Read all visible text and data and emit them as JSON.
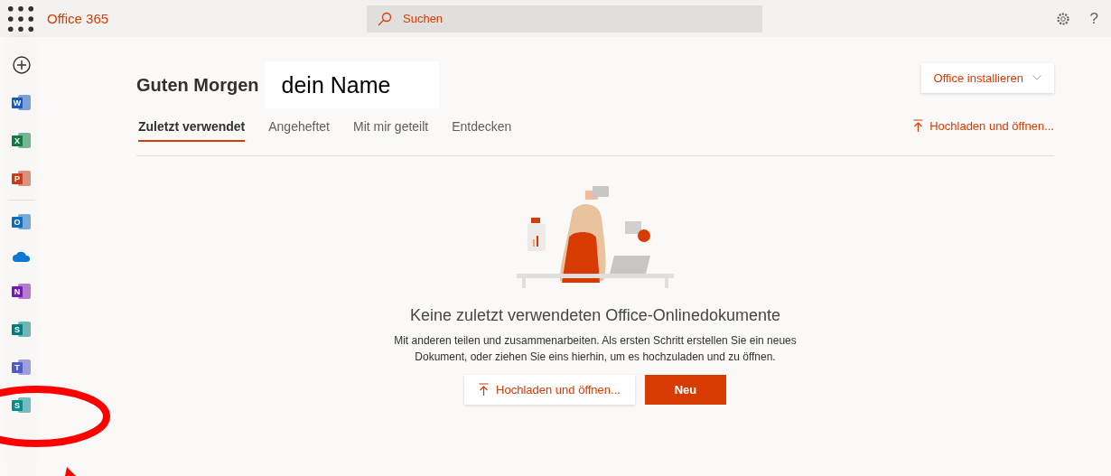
{
  "top_bar": {
    "brand": "Office 365",
    "search": {
      "placeholder": "Suchen"
    },
    "help": "?"
  },
  "sidebar": {
    "items": [
      {
        "kind": "create"
      },
      {
        "kind": "app",
        "letter": "W",
        "color": "#185abd"
      },
      {
        "kind": "app",
        "letter": "X",
        "color": "#107c41"
      },
      {
        "kind": "app",
        "letter": "P",
        "color": "#c43e1c"
      },
      {
        "kind": "divider"
      },
      {
        "kind": "app",
        "letter": "O",
        "color": "#0f6cbd"
      },
      {
        "kind": "cloud",
        "color": "#0f78d4"
      },
      {
        "kind": "app",
        "letter": "N",
        "color": "#7719aa"
      },
      {
        "kind": "app",
        "letter": "S",
        "color": "#037c7e"
      },
      {
        "kind": "app",
        "letter": "T",
        "color": "#5059c9"
      },
      {
        "kind": "app",
        "letter": "S",
        "color": "#078d8f"
      }
    ]
  },
  "header": {
    "greeting": "Guten Morgen",
    "name_box": "dein Name",
    "install_button": "Office installieren"
  },
  "tabs": [
    {
      "label": "Zuletzt verwendet",
      "selected": true
    },
    {
      "label": "Angeheftet",
      "selected": false
    },
    {
      "label": "Mit mir geteilt",
      "selected": false
    },
    {
      "label": "Entdecken",
      "selected": false
    }
  ],
  "upload_link": "Hochladen und öffnen...",
  "empty_state": {
    "title": "Keine zuletzt verwendeten Office-Onlinedokumente",
    "text": "Mit anderen teilen und zusammenarbeiten. Als ersten Schritt erstellen Sie ein neues Dokument, oder ziehen Sie eins hierhin, um es hochzuladen und zu öffnen.",
    "buttons": [
      {
        "label": "Hochladen und öffnen...",
        "kind": "secondary"
      },
      {
        "label": "Neu",
        "kind": "primary"
      }
    ]
  }
}
